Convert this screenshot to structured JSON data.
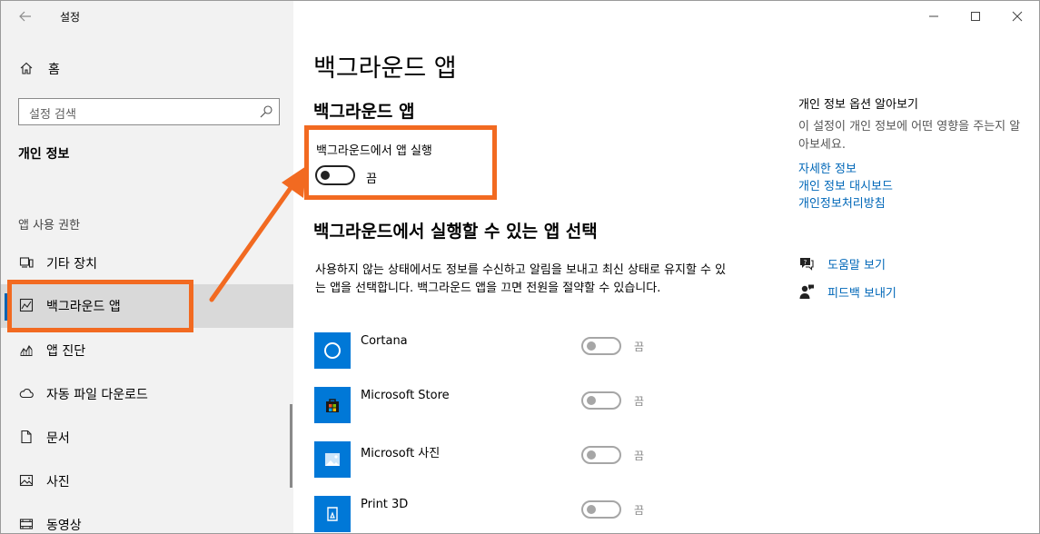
{
  "window": {
    "title": "설정",
    "controls": {
      "minimize": "—",
      "maximize": "☐",
      "close": "✕"
    }
  },
  "sidebar": {
    "home_label": "홈",
    "search_placeholder": "설정 검색",
    "section_title": "개인 정보",
    "group_title": "앱 사용 권한",
    "items": [
      {
        "label": "기타 장치",
        "icon": "devices-icon"
      },
      {
        "label": "백그라운드 앱",
        "icon": "background-apps-icon",
        "selected": true
      },
      {
        "label": "앱 진단",
        "icon": "diagnostics-icon"
      },
      {
        "label": "자동 파일 다운로드",
        "icon": "cloud-icon"
      },
      {
        "label": "문서",
        "icon": "document-icon"
      },
      {
        "label": "사진",
        "icon": "pictures-icon"
      },
      {
        "label": "동영상",
        "icon": "video-icon"
      }
    ]
  },
  "main": {
    "page_title": "백그라운드 앱",
    "sub_title": "백그라운드 앱",
    "bg_run_label": "백그라운드에서 앱 실행",
    "bg_run_state": "끔",
    "bg_run_on": false,
    "choose_title": "백그라운드에서 실행할 수 있는 앱 선택",
    "description": "사용하지 않는 상태에서도 정보를 수신하고 알림을 보내고 최신 상태로 유지할 수 있는 앱을 선택합니다. 백그라운드 앱을 끄면 전원을 절약할 수 있습니다.",
    "apps": [
      {
        "name": "Cortana",
        "state": "끔",
        "icon": "cortana-icon"
      },
      {
        "name": "Microsoft Store",
        "state": "끔",
        "icon": "store-icon"
      },
      {
        "name": "Microsoft 사진",
        "state": "끔",
        "icon": "photos-icon"
      },
      {
        "name": "Print 3D",
        "state": "끔",
        "icon": "print3d-icon"
      }
    ]
  },
  "info_panel": {
    "title": "개인 정보 옵션 알아보기",
    "description": "이 설정이 개인 정보에 어떤 영향을 주는지 알아보세요.",
    "links": [
      "자세한 정보",
      "개인 정보 대시보드",
      "개인정보처리방침"
    ],
    "help_label": "도움말 보기",
    "feedback_label": "피드백 보내기"
  },
  "colors": {
    "accent": "#0078d7",
    "link": "#0067b8",
    "highlight": "#f26a21"
  }
}
